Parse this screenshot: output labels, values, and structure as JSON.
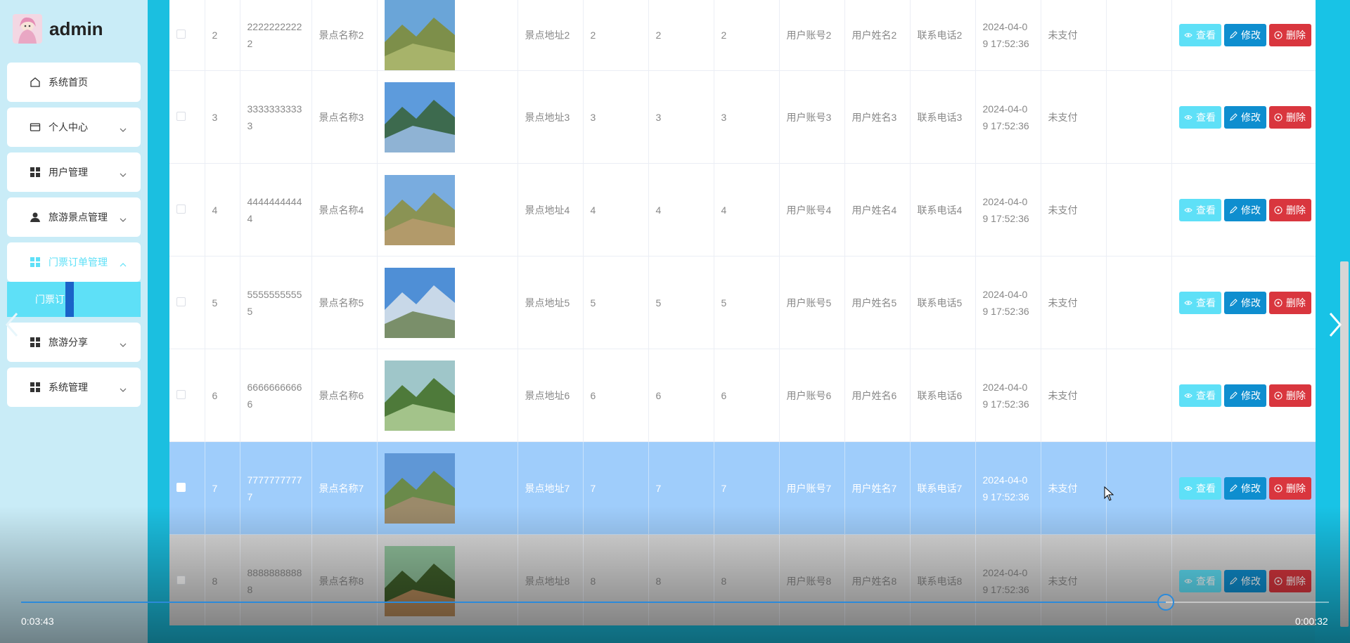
{
  "sidebar": {
    "brand": "admin",
    "items": [
      {
        "label": "系统首页",
        "icon": "home-icon"
      },
      {
        "label": "个人中心",
        "icon": "card-icon"
      },
      {
        "label": "用户管理",
        "icon": "grid-icon"
      },
      {
        "label": "旅游景点管理",
        "icon": "user-icon"
      },
      {
        "label": "门票订单管理",
        "icon": "grid-icon"
      },
      {
        "label": "旅游分享",
        "icon": "grid-icon"
      },
      {
        "label": "系统管理",
        "icon": "grid-icon"
      }
    ],
    "submenu_label": "门票订单",
    "active_color": "#5ee0f7"
  },
  "table": {
    "rows": [
      {
        "id": "2",
        "order_no": "2222222222",
        "order_tail": "2",
        "scenic": "景点名称2",
        "address": "景点地址2",
        "c1": "2",
        "c2": "2",
        "c3": "2",
        "account": "用户账号2",
        "name": "用户姓名2",
        "phone": "联系电话2",
        "time1": "2024-04-0",
        "time2": "9 17:52:36",
        "status": "未支付"
      },
      {
        "id": "3",
        "order_no": "3333333333",
        "order_tail": "3",
        "scenic": "景点名称3",
        "address": "景点地址3",
        "c1": "3",
        "c2": "3",
        "c3": "3",
        "account": "用户账号3",
        "name": "用户姓名3",
        "phone": "联系电话3",
        "time1": "2024-04-0",
        "time2": "9 17:52:36",
        "status": "未支付"
      },
      {
        "id": "4",
        "order_no": "4444444444",
        "order_tail": "4",
        "scenic": "景点名称4",
        "address": "景点地址4",
        "c1": "4",
        "c2": "4",
        "c3": "4",
        "account": "用户账号4",
        "name": "用户姓名4",
        "phone": "联系电话4",
        "time1": "2024-04-0",
        "time2": "9 17:52:36",
        "status": "未支付"
      },
      {
        "id": "5",
        "order_no": "5555555555",
        "order_tail": "5",
        "scenic": "景点名称5",
        "address": "景点地址5",
        "c1": "5",
        "c2": "5",
        "c3": "5",
        "account": "用户账号5",
        "name": "用户姓名5",
        "phone": "联系电话5",
        "time1": "2024-04-0",
        "time2": "9 17:52:36",
        "status": "未支付"
      },
      {
        "id": "6",
        "order_no": "6666666666",
        "order_tail": "6",
        "scenic": "景点名称6",
        "address": "景点地址6",
        "c1": "6",
        "c2": "6",
        "c3": "6",
        "account": "用户账号6",
        "name": "用户姓名6",
        "phone": "联系电话6",
        "time1": "2024-04-0",
        "time2": "9 17:52:36",
        "status": "未支付"
      },
      {
        "id": "7",
        "order_no": "7777777777",
        "order_tail": "7",
        "scenic": "景点名称7",
        "address": "景点地址7",
        "c1": "7",
        "c2": "7",
        "c3": "7",
        "account": "用户账号7",
        "name": "用户姓名7",
        "phone": "联系电话7",
        "time1": "2024-04-0",
        "time2": "9 17:52:36",
        "status": "未支付"
      },
      {
        "id": "8",
        "order_no": "8888888888",
        "order_tail": "8",
        "scenic": "景点名称8",
        "address": "景点地址8",
        "c1": "8",
        "c2": "8",
        "c3": "8",
        "account": "用户账号8",
        "name": "用户姓名8",
        "phone": "联系电话8",
        "time1": "2024-04-0",
        "time2": "9 17:52:36",
        "status": "未支付"
      }
    ],
    "view_label": "查看",
    "edit_label": "修改",
    "delete_label": "删除",
    "selected_row_id": "7",
    "colors": {
      "view": "#5ee0f7",
      "edit": "#0e8ecf",
      "delete": "#d9363e",
      "selected_row": "#9fcdfb"
    }
  },
  "video": {
    "elapsed": "0:03:43",
    "remaining": "0:00:32",
    "progress_fraction": 0.875
  }
}
